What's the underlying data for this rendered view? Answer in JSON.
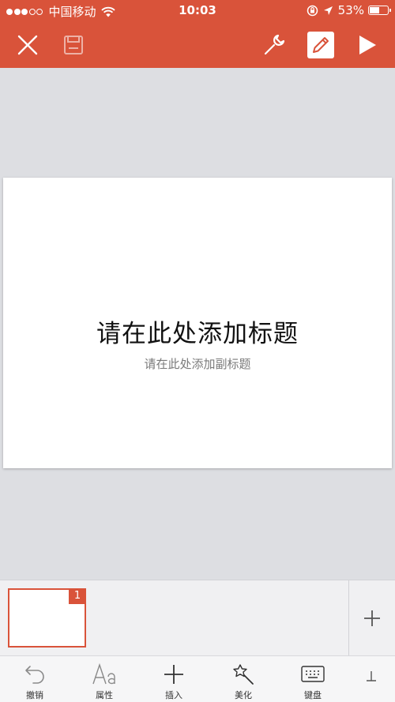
{
  "status_bar": {
    "carrier": "中国移动",
    "time": "10:03",
    "battery_percent": "53%",
    "battery_level": 0.53
  },
  "toolbar": {
    "close_icon": "close-icon",
    "save_icon": "save-icon",
    "wrench_icon": "wrench-icon",
    "edit_icon": "pencil-icon",
    "play_icon": "play-icon"
  },
  "slide": {
    "title_placeholder": "请在此处添加标题",
    "subtitle_placeholder": "请在此处添加副标题"
  },
  "thumbnails": {
    "items": [
      {
        "number": "1"
      }
    ]
  },
  "bottom_bar": {
    "undo_label": "撤销",
    "properties_label": "属性",
    "insert_label": "插入",
    "beautify_label": "美化",
    "keyboard_label": "键盘"
  },
  "colors": {
    "accent": "#d9533a",
    "canvas": "#dddee2"
  }
}
